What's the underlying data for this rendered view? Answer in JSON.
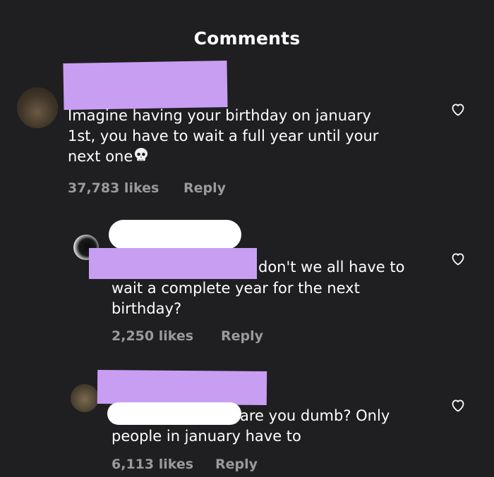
{
  "header": {
    "title": "Comments"
  },
  "comments": [
    {
      "text_lines": [
        "Imagine having your birthday on january",
        "1st, you have to wait a full year until your",
        "next one"
      ],
      "emoji": "💀",
      "likes": "37,783 likes",
      "reply": "Reply",
      "avatar_icon": "avatar-photo",
      "like_icon": "heart-outline-icon"
    },
    {
      "text_lines": [
        "don't we all have to",
        "wait a complete year for the next",
        "birthday?"
      ],
      "likes": "2,250 likes",
      "reply": "Reply",
      "avatar_icon": "avatar-photo",
      "like_icon": "heart-outline-icon"
    },
    {
      "text_lines": [
        "are you dumb? Only",
        "people in january have to"
      ],
      "likes": "6,113 likes",
      "reply": "Reply",
      "avatar_icon": "avatar-photo",
      "like_icon": "heart-outline-icon"
    }
  ],
  "colors": {
    "background": "#1f1f21",
    "redaction_purple": "#c89ef3",
    "redaction_white": "#ffffff",
    "meta_gray": "#9a9a9a"
  }
}
